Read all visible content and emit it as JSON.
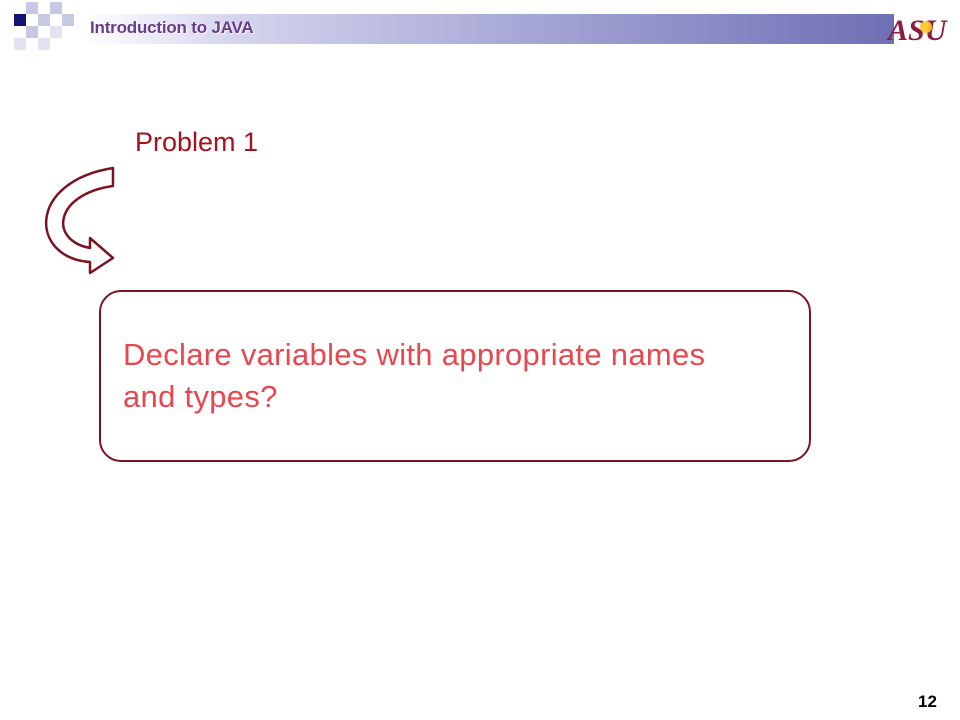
{
  "header": {
    "title": "Introduction to JAVA",
    "logo_text": "ASU"
  },
  "slide": {
    "label": "Problem 1",
    "question": "Declare variables with appropriate names and types?",
    "page_number": "12"
  },
  "colors": {
    "label": "#a3121d",
    "question_text": "#e8474d",
    "box_border": "#7a1420",
    "header_title": "#6a3b8c",
    "logo": "#8c1d40"
  }
}
